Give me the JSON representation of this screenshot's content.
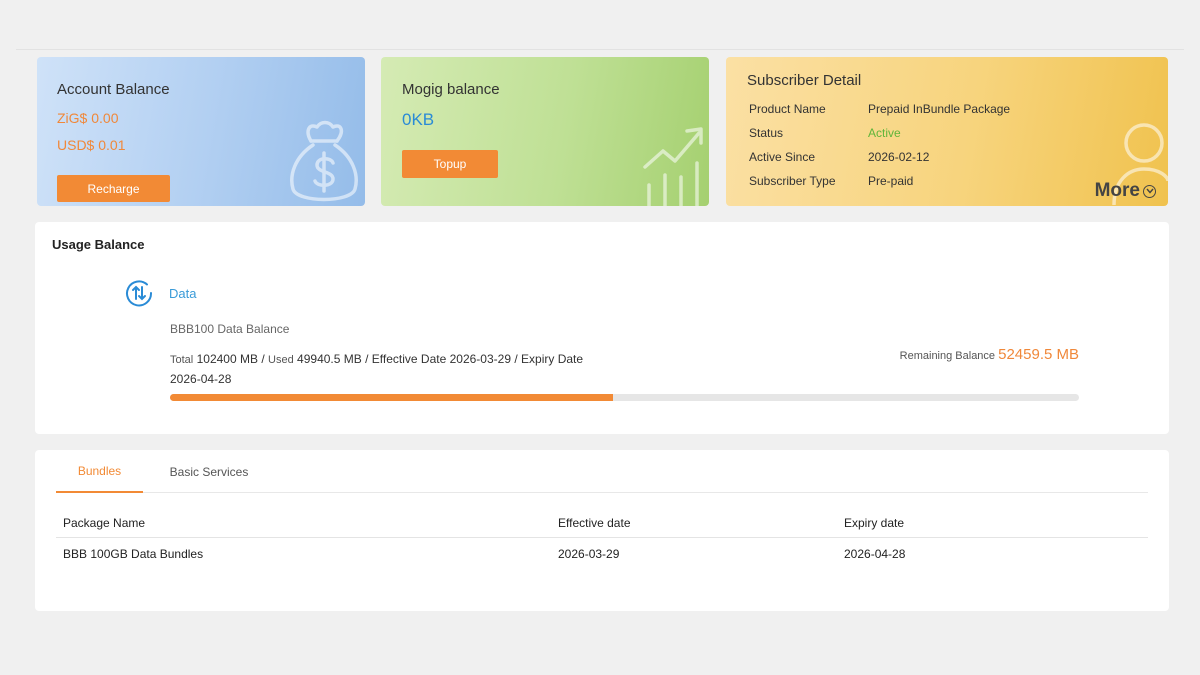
{
  "account": {
    "title": "Account Balance",
    "zig": "ZiG$ 0.00",
    "usd": "USD$ 0.01",
    "recharge_label": "Recharge",
    "icon": "money-bag-icon"
  },
  "mogig": {
    "title": "Mogig balance",
    "amount": "0KB",
    "topup_label": "Topup",
    "icon": "growth-chart-icon"
  },
  "subscriber": {
    "title": "Subscriber Detail",
    "rows": [
      {
        "key": "Product Name",
        "value": "Prepaid InBundle Package"
      },
      {
        "key": "Status",
        "value": "Active"
      },
      {
        "key": "Active Since",
        "value": "2026-02-12"
      },
      {
        "key": "Subscriber Type",
        "value": "Pre-paid"
      }
    ],
    "more_label": "More",
    "icon": "user-icon"
  },
  "usage": {
    "title": "Usage Balance",
    "data_label": "Data",
    "bundle_name": "BBB100 Data Balance",
    "total_label": "Total",
    "total_value": "102400 MB",
    "used_label": "Used",
    "used_value": "49940.5 MB",
    "effective_text": "Effective Date 2026-03-29",
    "expiry_text": "Expiry Date 2026-04-28",
    "remaining_label": "Remaining Balance",
    "remaining_value": "52459.5 MB",
    "used_fraction": 0.4877
  },
  "bundles": {
    "tabs": [
      "Bundles",
      "Basic Services"
    ],
    "headers": [
      "Package Name",
      "Effective date",
      "Expiry date"
    ],
    "rows": [
      [
        "BBB 100GB Data Bundles",
        "2026-03-29",
        "2026-04-28"
      ]
    ]
  },
  "colors": {
    "accent": "#f28a35",
    "link": "#3a9bd8",
    "active": "#5fb53a"
  }
}
